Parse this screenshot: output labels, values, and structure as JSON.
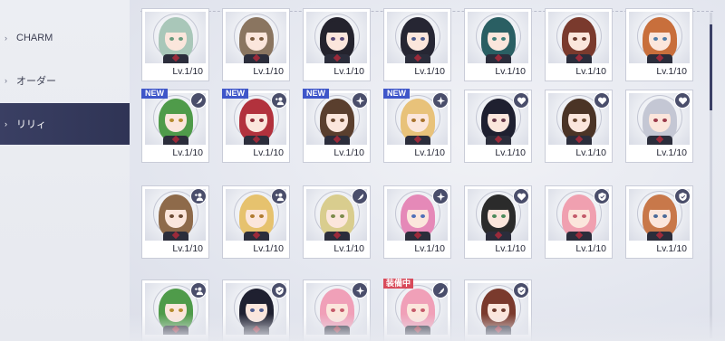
{
  "sidebar": {
    "items": [
      {
        "label": "CHARM",
        "active": false
      },
      {
        "label": "オーダー",
        "active": false
      },
      {
        "label": "リリィ",
        "active": true
      }
    ]
  },
  "colors": {
    "accent_nav": "#353a5c",
    "new_badge": "#3f56c9",
    "equip_badge": "#d84a5a",
    "type_icon": "#4a4e6b"
  },
  "grid": {
    "rows": [
      {
        "cards": [
          {
            "level": "Lv.1/10",
            "hair": "#a9c7b9",
            "eyes": "#6a9a7e",
            "icon": "none"
          },
          {
            "level": "Lv.1/10",
            "hair": "#8a7560",
            "eyes": "#7b5b3f",
            "icon": "none"
          },
          {
            "level": "Lv.1/10",
            "hair": "#24232d",
            "eyes": "#5a4a7a",
            "icon": "none"
          },
          {
            "level": "Lv.1/10",
            "hair": "#262633",
            "eyes": "#4d5b8f",
            "icon": "none"
          },
          {
            "level": "Lv.1/10",
            "hair": "#2a5f63",
            "eyes": "#3f7f7a",
            "icon": "none"
          },
          {
            "level": "Lv.1/10",
            "hair": "#7a3a2d",
            "eyes": "#6b3a2d",
            "icon": "none"
          },
          {
            "level": "Lv.1/10",
            "hair": "#c86f3c",
            "eyes": "#4f7ca8",
            "icon": "none"
          }
        ]
      },
      {
        "cards": [
          {
            "level": "Lv.1/10",
            "badge": "NEW",
            "hair": "#4f9b4a",
            "eyes": "#b48b2e",
            "icon": "feather-icon"
          },
          {
            "level": "Lv.1/10",
            "badge": "NEW",
            "hair": "#b2323d",
            "eyes": "#8c2a35",
            "icon": "plus-person-icon"
          },
          {
            "level": "Lv.1/10",
            "badge": "NEW",
            "hair": "#5a3f2e",
            "eyes": "#6b4a33",
            "icon": "sparkle-icon"
          },
          {
            "level": "Lv.1/10",
            "badge": "NEW",
            "hair": "#e8c27a",
            "eyes": "#a8732e",
            "icon": "sparkle-icon"
          },
          {
            "level": "Lv.1/10",
            "hair": "#1f2030",
            "eyes": "#6a3a4a",
            "icon": "heart-icon"
          },
          {
            "level": "Lv.1/10",
            "hair": "#4b3426",
            "eyes": "#6b4a33",
            "icon": "heart-icon"
          },
          {
            "level": "Lv.1/10",
            "hair": "#c4c7d4",
            "eyes": "#9a3a4a",
            "icon": "heart-icon"
          }
        ]
      },
      {
        "cards": [
          {
            "level": "Lv.1/10",
            "hair": "#8e6a4a",
            "eyes": "#6b4a33",
            "icon": "plus-person-icon"
          },
          {
            "level": "Lv.1/10",
            "hair": "#e6c26e",
            "eyes": "#b07a2e",
            "icon": "plus-person-icon"
          },
          {
            "level": "Lv.1/10",
            "hair": "#d9cd8e",
            "eyes": "#7b8a4a",
            "icon": "feather-icon"
          },
          {
            "level": "Lv.1/10",
            "hair": "#e589b8",
            "eyes": "#4f6fb8",
            "icon": "sparkle-icon"
          },
          {
            "level": "Lv.1/10",
            "hair": "#2b2b2b",
            "eyes": "#4a8a5a",
            "icon": "heart-icon"
          },
          {
            "level": "Lv.1/10",
            "hair": "#f0a0b0",
            "eyes": "#c45a6a",
            "icon": "shield-icon"
          },
          {
            "level": "Lv.1/10",
            "hair": "#c8784a",
            "eyes": "#4a6a9a",
            "icon": "shield-icon"
          }
        ]
      },
      {
        "cards": [
          {
            "level": "",
            "hair": "#4f9b4a",
            "eyes": "#b48b2e",
            "icon": "plus-person-icon"
          },
          {
            "level": "",
            "hair": "#1f2030",
            "eyes": "#4d5b8f",
            "icon": "shield-icon"
          },
          {
            "level": "",
            "hair": "#f0a0b8",
            "eyes": "#c45a6a",
            "icon": "sparkle-icon"
          },
          {
            "level": "",
            "badge": "装備中",
            "hair": "#f0a0b8",
            "eyes": "#c45a6a",
            "icon": "feather-icon"
          },
          {
            "level": "",
            "hair": "#7a3a2d",
            "eyes": "#6b3a2d",
            "icon": "shield-icon"
          }
        ]
      }
    ]
  }
}
